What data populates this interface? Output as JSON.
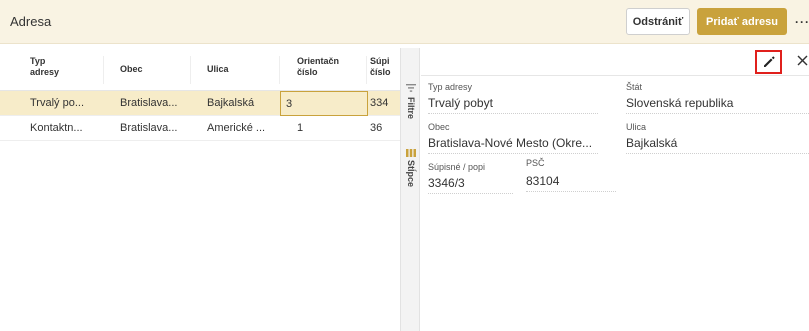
{
  "header": {
    "title": "Adresa",
    "remove_label": "Odstrániť",
    "add_label": "Pridať adresu",
    "more_label": "···"
  },
  "table": {
    "columns": [
      "Typ adresy",
      "Obec",
      "Ulica",
      "Orientačné číslo",
      "Súpisné číslo"
    ],
    "column_text": {
      "typ_line1": "Typ",
      "typ_line2": "adresy",
      "obec": "Obec",
      "ulica": "Ulica",
      "orient_line1": "Orientačn",
      "orient_line2": "číslo",
      "supis_line1": "Súpi",
      "supis_line2": "číslo"
    },
    "rows": [
      {
        "typ": "Trvalý po...",
        "obec": "Bratislava...",
        "ulica": "Bajkalská",
        "orient": "3",
        "supis": "334"
      },
      {
        "typ": "Kontaktn...",
        "obec": "Bratislava...",
        "ulica": "Americké ...",
        "orient": "1",
        "supis": "36"
      }
    ]
  },
  "side_tabs": {
    "filters": "Filtre",
    "columns": "Stĺpce"
  },
  "detail": {
    "fields": {
      "typ_label": "Typ adresy",
      "typ_value": "Trvalý pobyt",
      "stat_label": "Štát",
      "stat_value": "Slovenská republika",
      "obec_label": "Obec",
      "obec_value": "Bratislava-Nové Mesto (Okre...",
      "ulica_label": "Ulica",
      "ulica_value": "Bajkalská",
      "supis_label": "Súpisné / popi",
      "supis_value": "3346/3",
      "psc_label": "PSČ",
      "psc_value": "83104"
    }
  },
  "colors": {
    "accent": "#c9a23c",
    "header_bg": "#f9f3e3",
    "selected_row": "#f7ecc9",
    "highlight_border": "#e0201c"
  },
  "icons": [
    "filter-icon",
    "columns-icon",
    "pencil-icon",
    "close-icon"
  ]
}
